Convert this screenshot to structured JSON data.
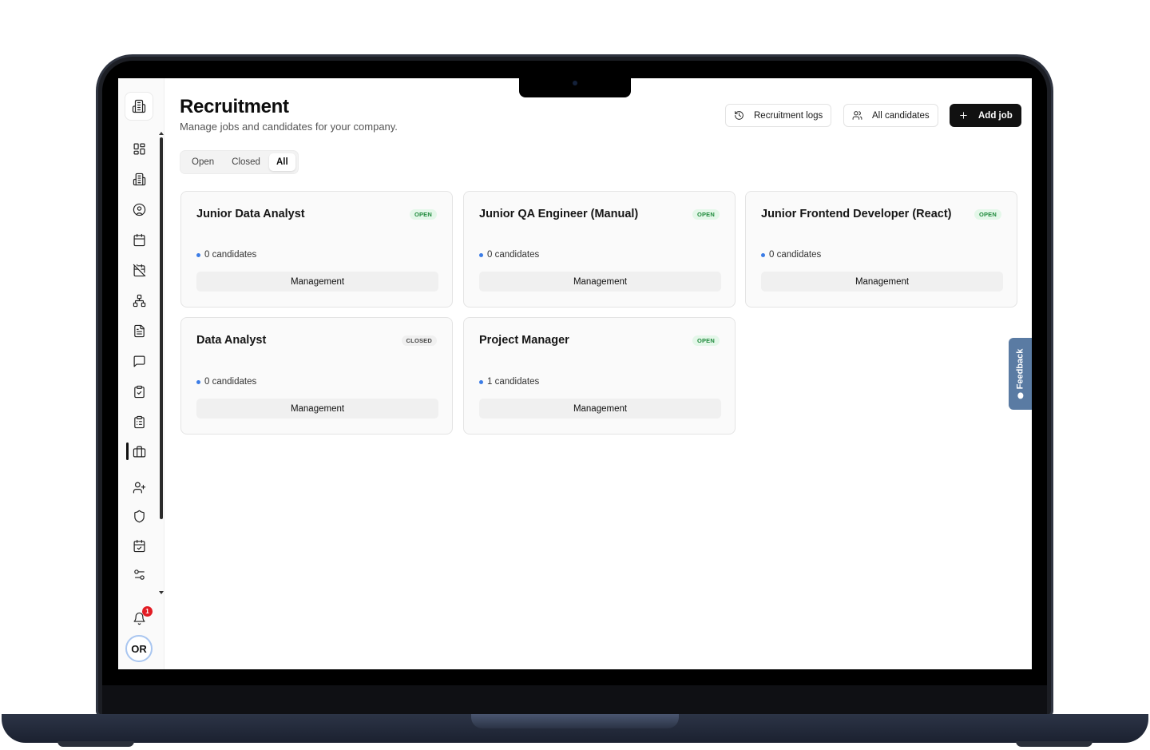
{
  "app": {
    "sidebar": {
      "items": [
        {
          "name": "sidebar-item-dashboard",
          "icon": "grid-icon"
        },
        {
          "name": "sidebar-item-company",
          "icon": "building-icon"
        },
        {
          "name": "sidebar-item-profile",
          "icon": "user-circle-icon"
        },
        {
          "name": "sidebar-item-calendar",
          "icon": "calendar-icon"
        },
        {
          "name": "sidebar-item-time-off",
          "icon": "calendar-off-icon"
        },
        {
          "name": "sidebar-item-org-chart",
          "icon": "org-chart-icon"
        },
        {
          "name": "sidebar-item-documents",
          "icon": "document-icon"
        },
        {
          "name": "sidebar-item-messages",
          "icon": "chat-icon"
        },
        {
          "name": "sidebar-item-tasks",
          "icon": "clipboard-check-icon"
        },
        {
          "name": "sidebar-item-reports",
          "icon": "clipboard-list-icon"
        },
        {
          "name": "sidebar-item-recruitment",
          "icon": "briefcase-icon",
          "active": true
        },
        {
          "name": "sidebar-item-add-user",
          "icon": "user-plus-icon"
        },
        {
          "name": "sidebar-item-security",
          "icon": "shield-icon"
        },
        {
          "name": "sidebar-item-schedule",
          "icon": "calendar-check-icon"
        },
        {
          "name": "sidebar-item-settings",
          "icon": "sliders-icon"
        }
      ],
      "notification_count": "1",
      "avatar_initials": "OR"
    },
    "header": {
      "title": "Recruitment",
      "subtitle": "Manage jobs and candidates for your company.",
      "buttons": {
        "logs": "Recruitment logs",
        "candidates": "All candidates",
        "add_job": "Add job"
      }
    },
    "tabs": [
      {
        "label": "Open",
        "active": false
      },
      {
        "label": "Closed",
        "active": false
      },
      {
        "label": "All",
        "active": true
      }
    ],
    "jobs": [
      {
        "title": "Junior Data Analyst",
        "status": "OPEN",
        "candidates": "0 candidates",
        "department": "Management"
      },
      {
        "title": "Junior QA Engineer (Manual)",
        "status": "OPEN",
        "candidates": "0 candidates",
        "department": "Management"
      },
      {
        "title": "Junior Frontend Developer (React)",
        "status": "OPEN",
        "candidates": "0 candidates",
        "department": "Management"
      },
      {
        "title": "Data Analyst",
        "status": "CLOSED",
        "candidates": "0 candidates",
        "department": "Management"
      },
      {
        "title": "Project Manager",
        "status": "OPEN",
        "candidates": "1 candidates",
        "department": "Management"
      }
    ],
    "feedback_label": "Feedback",
    "colors": {
      "accent": "#111111",
      "open_badge": "#1f8a3c",
      "candidate_dot": "#3b7ce6",
      "notification": "#e21c24",
      "feedback_tab": "#5a7ba3"
    }
  }
}
